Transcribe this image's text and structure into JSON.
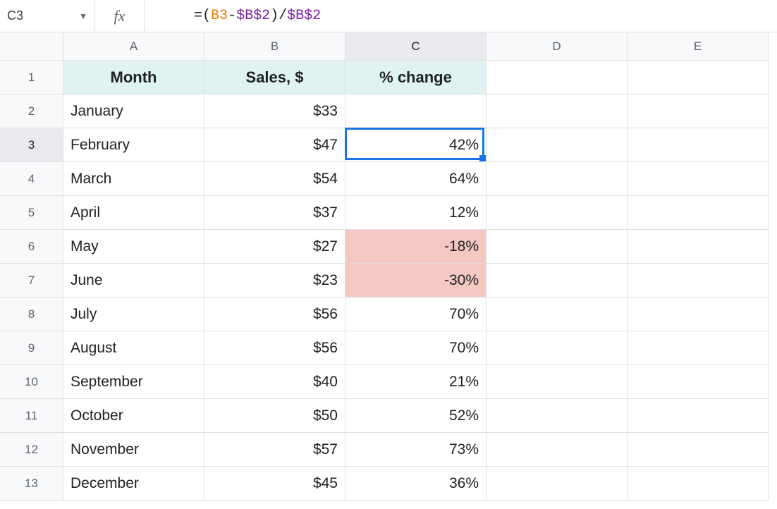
{
  "namebox": "C3",
  "fx_label": "fx",
  "formula": {
    "eq": "=",
    "open": "(",
    "b3": "B3",
    "minus": "-",
    "b2a": "$B$2",
    "close": ")",
    "slash": "/",
    "b2b": "$B$2"
  },
  "columns": [
    "A",
    "B",
    "C",
    "D",
    "E"
  ],
  "selected_col_index": 2,
  "row_labels": [
    "1",
    "2",
    "3",
    "4",
    "5",
    "6",
    "7",
    "8",
    "9",
    "10",
    "11",
    "12",
    "13"
  ],
  "selected_row_index": 2,
  "headers": {
    "month": "Month",
    "sales": "Sales, $",
    "change": "% change"
  },
  "data": [
    {
      "month": "January",
      "sales": "$33",
      "change": "",
      "neg": false
    },
    {
      "month": "February",
      "sales": "$47",
      "change": "42%",
      "neg": false
    },
    {
      "month": "March",
      "sales": "$54",
      "change": "64%",
      "neg": false
    },
    {
      "month": "April",
      "sales": "$37",
      "change": "12%",
      "neg": false
    },
    {
      "month": "May",
      "sales": "$27",
      "change": "-18%",
      "neg": true
    },
    {
      "month": "June",
      "sales": "$23",
      "change": "-30%",
      "neg": true
    },
    {
      "month": "July",
      "sales": "$56",
      "change": "70%",
      "neg": false
    },
    {
      "month": "August",
      "sales": "$56",
      "change": "70%",
      "neg": false
    },
    {
      "month": "September",
      "sales": "$40",
      "change": "21%",
      "neg": false
    },
    {
      "month": "October",
      "sales": "$50",
      "change": "52%",
      "neg": false
    },
    {
      "month": "November",
      "sales": "$57",
      "change": "73%",
      "neg": false
    },
    {
      "month": "December",
      "sales": "$45",
      "change": "36%",
      "neg": false
    }
  ],
  "selected_cell": {
    "col": 2,
    "row": 2
  }
}
